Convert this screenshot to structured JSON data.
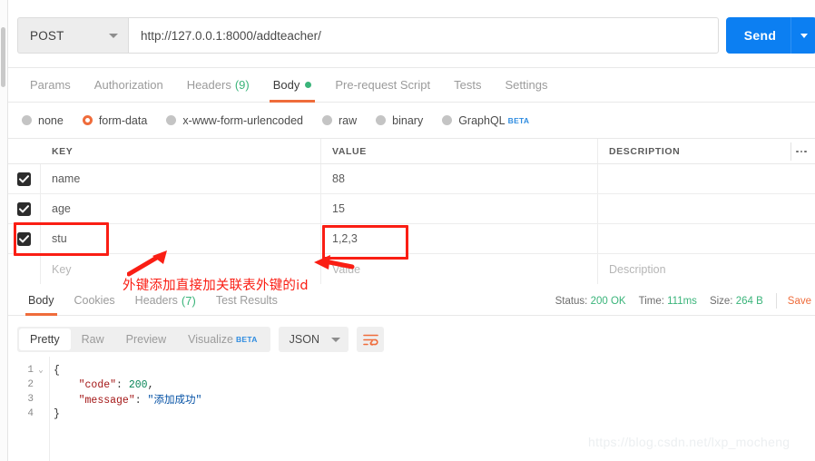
{
  "request": {
    "method": "POST",
    "method_caret": "chevron-down-icon",
    "url": "http://127.0.0.1:8000/addteacher/",
    "url_placeholder": "Enter request URL",
    "send_label": "Send"
  },
  "request_tabs": [
    {
      "label": "Params",
      "active": false,
      "count": "",
      "dot": false
    },
    {
      "label": "Authorization",
      "active": false,
      "count": "",
      "dot": false
    },
    {
      "label": "Headers",
      "active": false,
      "count": "(9)",
      "dot": false
    },
    {
      "label": "Body",
      "active": true,
      "count": "",
      "dot": true
    },
    {
      "label": "Pre-request Script",
      "active": false,
      "count": "",
      "dot": false
    },
    {
      "label": "Tests",
      "active": false,
      "count": "",
      "dot": false
    },
    {
      "label": "Settings",
      "active": false,
      "count": "",
      "dot": false
    }
  ],
  "body_types": [
    {
      "label": "none",
      "selected": false,
      "beta": ""
    },
    {
      "label": "form-data",
      "selected": true,
      "beta": ""
    },
    {
      "label": "x-www-form-urlencoded",
      "selected": false,
      "beta": ""
    },
    {
      "label": "raw",
      "selected": false,
      "beta": ""
    },
    {
      "label": "binary",
      "selected": false,
      "beta": ""
    },
    {
      "label": "GraphQL",
      "selected": false,
      "beta": "BETA"
    }
  ],
  "kv_table": {
    "headers": {
      "key": "KEY",
      "value": "VALUE",
      "description": "DESCRIPTION"
    },
    "more_icon": "ellipsis-icon",
    "rows": [
      {
        "checked": true,
        "key": "name",
        "value": "88",
        "description": ""
      },
      {
        "checked": true,
        "key": "age",
        "value": "15",
        "description": ""
      },
      {
        "checked": true,
        "key": "stu",
        "value": "1,2,3",
        "description": ""
      }
    ],
    "new_row": {
      "key_placeholder": "Key",
      "value_placeholder": "Value",
      "description_placeholder": "Description"
    }
  },
  "response_tabs": [
    {
      "label": "Body",
      "active": true,
      "count": ""
    },
    {
      "label": "Cookies",
      "active": false,
      "count": ""
    },
    {
      "label": "Headers",
      "active": false,
      "count": "(7)"
    },
    {
      "label": "Test Results",
      "active": false,
      "count": ""
    }
  ],
  "response_meta": {
    "status_label": "Status:",
    "status_value": "200 OK",
    "time_label": "Time:",
    "time_value": "111ms",
    "size_label": "Size:",
    "size_value": "264 B",
    "save_label": "Save"
  },
  "response_toolbar": {
    "segments": [
      {
        "label": "Pretty",
        "active": true,
        "beta": ""
      },
      {
        "label": "Raw",
        "active": false,
        "beta": ""
      },
      {
        "label": "Preview",
        "active": false,
        "beta": ""
      },
      {
        "label": "Visualize",
        "active": false,
        "beta": "BETA"
      }
    ],
    "format": "JSON",
    "format_caret": "chevron-down-icon",
    "wrap_icon": "wrap-lines-icon"
  },
  "response_body": {
    "lines": [
      {
        "n": "1",
        "fold": "v",
        "text": "{"
      },
      {
        "n": "2",
        "fold": "",
        "text": "    \"code\": 200,"
      },
      {
        "n": "3",
        "fold": "",
        "text": "    \"message\": \"添加成功\""
      },
      {
        "n": "4",
        "fold": "",
        "text": "}"
      }
    ],
    "json": {
      "code": 200,
      "message": "添加成功"
    }
  },
  "annotations": {
    "note": "外键添加直接加关联表外键的id",
    "highlight_key": "stu",
    "highlight_value": "1,2,3",
    "color": "#fa1e14"
  },
  "watermark": {
    "text": "https://blog.csdn.net/lxp_mocheng"
  },
  "colors": {
    "accent_orange": "#ef6c3b",
    "send_blue": "#0c7ff2",
    "status_green": "#3ab47a",
    "annotation_red": "#fa1e14"
  }
}
